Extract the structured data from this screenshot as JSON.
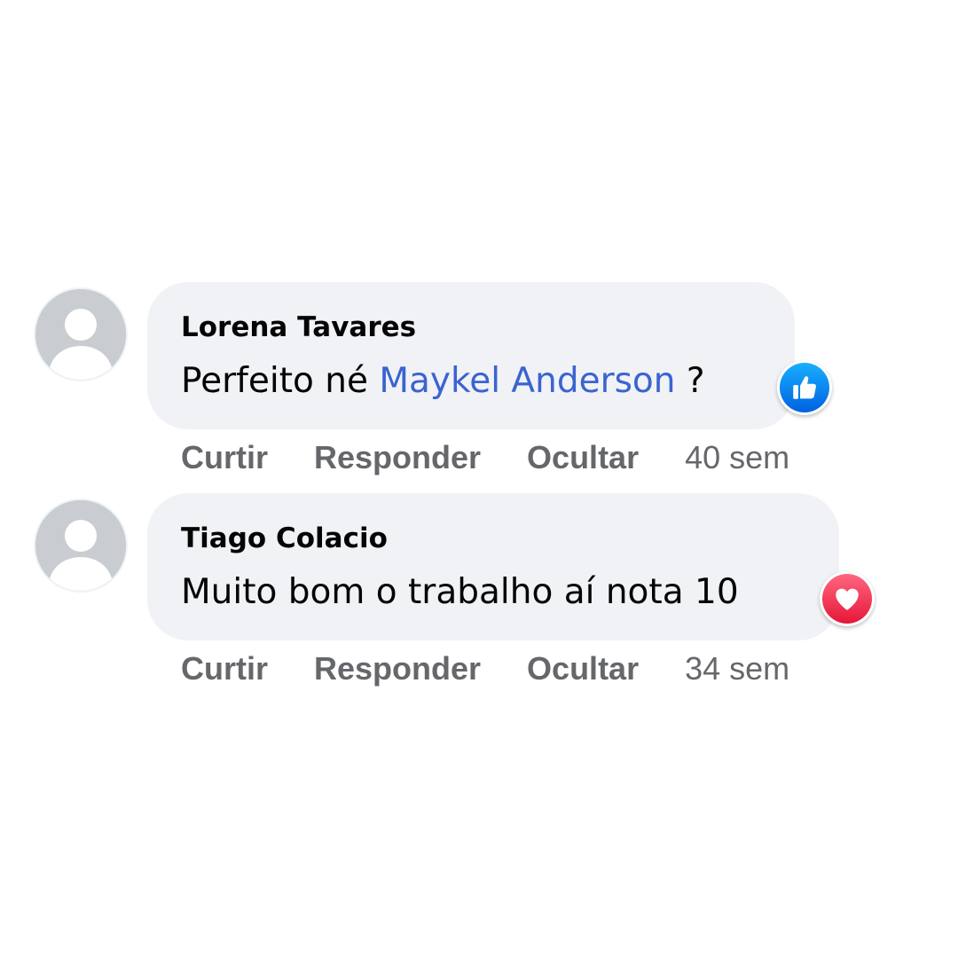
{
  "comments": [
    {
      "author": "Lorena Tavares",
      "text_before": "Perfeito né ",
      "mention": "Maykel Anderson",
      "text_after": " ?",
      "reaction": "like-icon",
      "actions": {
        "like": "Curtir",
        "reply": "Responder",
        "hide": "Ocultar"
      },
      "time": "40 sem"
    },
    {
      "author": "Tiago Colacio",
      "text_before": "Muito bom o trabalho aí nota 10",
      "mention": "",
      "text_after": "",
      "reaction": "heart-icon",
      "actions": {
        "like": "Curtir",
        "reply": "Responder",
        "hide": "Ocultar"
      },
      "time": "34 sem"
    }
  ],
  "colors": {
    "bubble": "#f0f2f5",
    "mention": "#3b63d1",
    "action_text": "#65676b",
    "like": "#1877f2",
    "love": "#f33e58"
  }
}
